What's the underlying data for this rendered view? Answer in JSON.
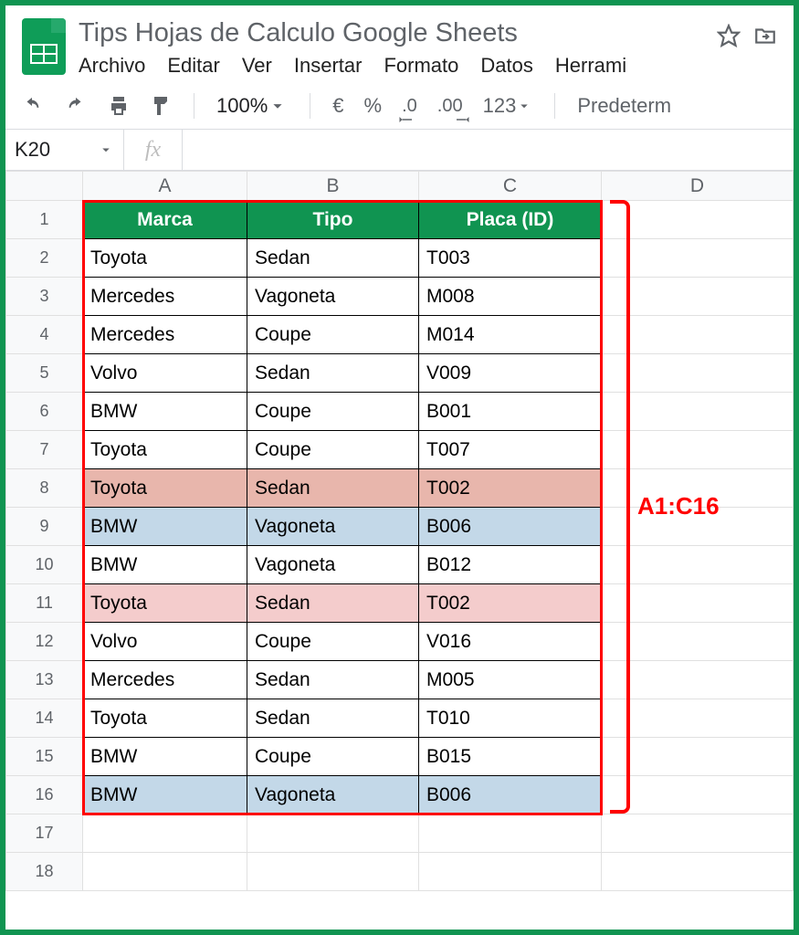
{
  "doc_title": "Tips Hojas de Calculo Google Sheets",
  "menu": {
    "file": "Archivo",
    "edit": "Editar",
    "view": "Ver",
    "insert": "Insertar",
    "format": "Formato",
    "data": "Datos",
    "tools": "Herrami"
  },
  "toolbar": {
    "zoom": "100%",
    "currency": "€",
    "percent": "%",
    "dec_less": ".0",
    "dec_more": ".00",
    "num_format": "123",
    "font_name": "Predeterm"
  },
  "name_box": "K20",
  "fx_label": "fx",
  "fx_value": "",
  "columns": [
    "A",
    "B",
    "C",
    "D"
  ],
  "row_numbers": [
    1,
    2,
    3,
    4,
    5,
    6,
    7,
    8,
    9,
    10,
    11,
    12,
    13,
    14,
    15,
    16,
    17,
    18
  ],
  "table": {
    "headers": [
      "Marca",
      "Tipo",
      "Placa (ID)"
    ],
    "rows": [
      {
        "marca": "Toyota",
        "tipo": "Sedan",
        "placa": "T003",
        "hl": ""
      },
      {
        "marca": "Mercedes",
        "tipo": "Vagoneta",
        "placa": "M008",
        "hl": ""
      },
      {
        "marca": "Mercedes",
        "tipo": "Coupe",
        "placa": "M014",
        "hl": ""
      },
      {
        "marca": "Volvo",
        "tipo": "Sedan",
        "placa": "V009",
        "hl": ""
      },
      {
        "marca": "BMW",
        "tipo": "Coupe",
        "placa": "B001",
        "hl": ""
      },
      {
        "marca": "Toyota",
        "tipo": "Coupe",
        "placa": "T007",
        "hl": ""
      },
      {
        "marca": "Toyota",
        "tipo": "Sedan",
        "placa": "T002",
        "hl": "hl-red"
      },
      {
        "marca": "BMW",
        "tipo": "Vagoneta",
        "placa": "B006",
        "hl": "hl-blue"
      },
      {
        "marca": "BMW",
        "tipo": "Vagoneta",
        "placa": "B012",
        "hl": ""
      },
      {
        "marca": "Toyota",
        "tipo": "Sedan",
        "placa": "T002",
        "hl": "hl-pink"
      },
      {
        "marca": "Volvo",
        "tipo": "Coupe",
        "placa": "V016",
        "hl": ""
      },
      {
        "marca": "Mercedes",
        "tipo": "Sedan",
        "placa": "M005",
        "hl": ""
      },
      {
        "marca": "Toyota",
        "tipo": "Sedan",
        "placa": "T010",
        "hl": ""
      },
      {
        "marca": "BMW",
        "tipo": "Coupe",
        "placa": "B015",
        "hl": ""
      },
      {
        "marca": "BMW",
        "tipo": "Vagoneta",
        "placa": "B006",
        "hl": "hl-blue"
      }
    ]
  },
  "range_label": "A1:C16"
}
